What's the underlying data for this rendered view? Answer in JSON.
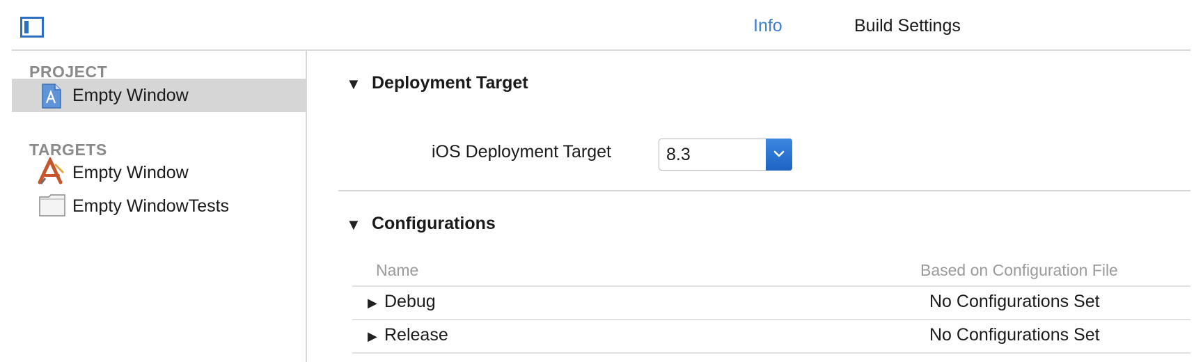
{
  "toolbar": {
    "tabs": [
      {
        "label": "Info",
        "active": true
      },
      {
        "label": "Build Settings",
        "active": false
      }
    ]
  },
  "navigator": {
    "project_header": "PROJECT",
    "project_item": "Empty Window",
    "targets_header": "TARGETS",
    "targets": [
      {
        "label": "Empty Window",
        "icon": "app-target-icon"
      },
      {
        "label": "Empty WindowTests",
        "icon": "test-bundle-icon"
      }
    ]
  },
  "deployment": {
    "title": "Deployment Target",
    "label": "iOS Deployment Target",
    "value": "8.3"
  },
  "configurations": {
    "title": "Configurations",
    "columns": [
      "Name",
      "Based on Configuration File"
    ],
    "rows": [
      {
        "name": "Debug",
        "file": "No Configurations Set"
      },
      {
        "name": "Release",
        "file": "No Configurations Set"
      }
    ]
  },
  "colors": {
    "accent": "#3f7fd0",
    "selection": "#d6d6d6",
    "muted": "#8a8a8a"
  }
}
